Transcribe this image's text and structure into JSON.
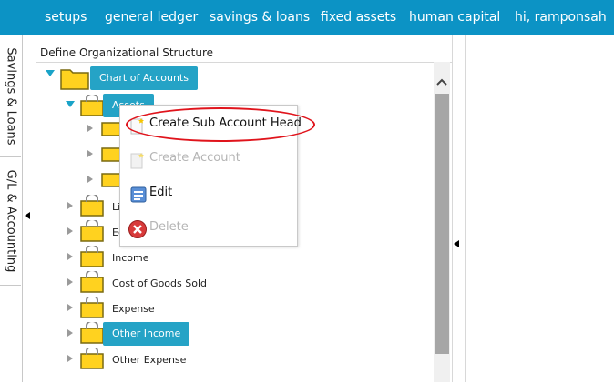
{
  "topnav": {
    "items": [
      "setups",
      "general ledger",
      "savings & loans",
      "fixed assets",
      "human capital",
      "hi, ramponsah"
    ]
  },
  "sidetabs": {
    "tabs": [
      "Savings & Loans",
      "G/L & Accounting"
    ]
  },
  "section": {
    "title": "Define Organizational Structure"
  },
  "tree": {
    "root": "Chart of Accounts",
    "assets": "Assets",
    "nodes": [
      "Li",
      "Eq",
      "Income",
      "Cost of Goods Sold",
      "Expense",
      "Other Income",
      "Other Expense"
    ]
  },
  "context_menu": {
    "items": [
      "Create Sub Account Head",
      "Create Account",
      "Edit",
      "Delete"
    ]
  },
  "colors": {
    "nav_bg": "#0c93c5",
    "selected": "#25a3c6",
    "highlight": "#e0141c"
  }
}
